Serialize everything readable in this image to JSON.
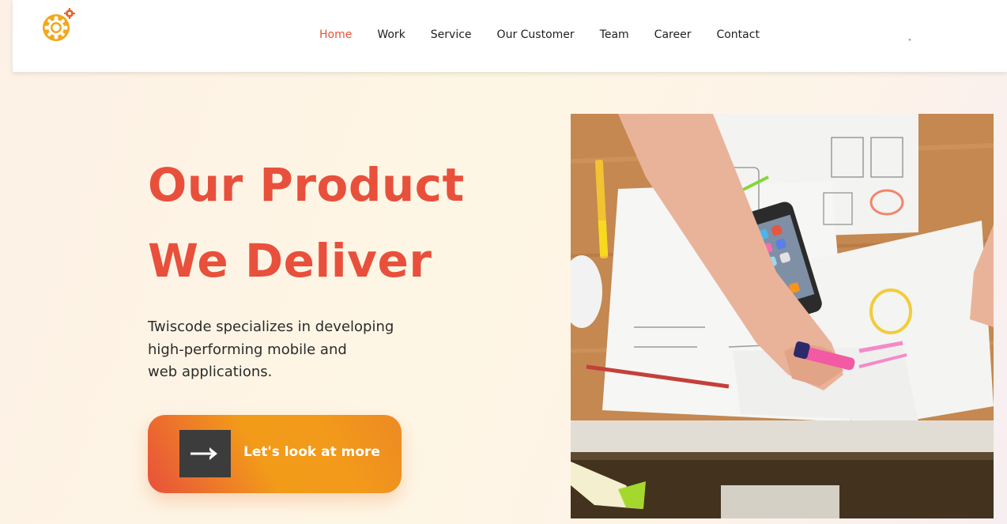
{
  "nav": {
    "items": [
      {
        "label": "Home",
        "active": true
      },
      {
        "label": "Work",
        "active": false
      },
      {
        "label": "Service",
        "active": false
      },
      {
        "label": "Our Customer",
        "active": false
      },
      {
        "label": "Team",
        "active": false
      },
      {
        "label": "Career",
        "active": false
      },
      {
        "label": "Contact",
        "active": false
      }
    ],
    "extra_glyph": "°"
  },
  "hero": {
    "title_line1": "Our Product",
    "title_line2": "We Deliver",
    "desc_line1": "Twiscode specializes in developing",
    "desc_line2": "high-performing mobile and",
    "desc_line3": "web applications.",
    "cta_label": "Let's look at more"
  },
  "colors": {
    "accent_red": "#e8503c",
    "accent_orange": "#f29b19",
    "logo_gold": "#f0a81c",
    "arrow_box": "#3c3c3c"
  },
  "icons": {
    "logo": "gear-logo-icon",
    "cta": "right-arrow-icon"
  }
}
